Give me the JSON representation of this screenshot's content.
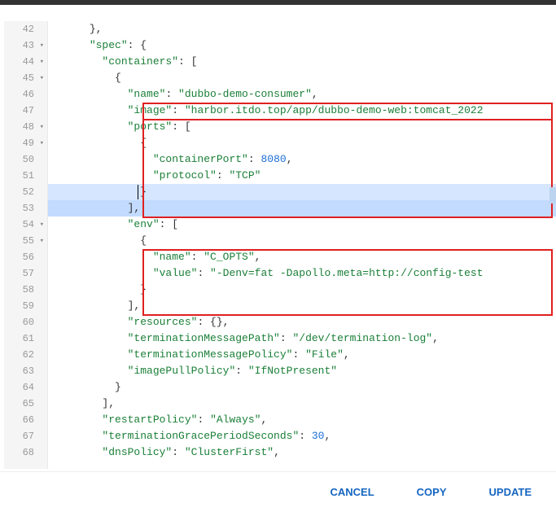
{
  "lines": [
    {
      "num": 42,
      "fold": "",
      "indent": 3,
      "html": "<span class='p'>},</span>"
    },
    {
      "num": 43,
      "fold": "▾",
      "indent": 3,
      "html": "<span class='k'>\"spec\"</span><span class='p'>: {</span>"
    },
    {
      "num": 44,
      "fold": "▾",
      "indent": 4,
      "html": "<span class='k'>\"containers\"</span><span class='p'>: [</span>"
    },
    {
      "num": 45,
      "fold": "▾",
      "indent": 5,
      "html": "<span class='p'>{</span>"
    },
    {
      "num": 46,
      "fold": "",
      "indent": 6,
      "html": "<span class='k'>\"name\"</span><span class='p'>: </span><span class='s'>\"dubbo-demo-consumer\"</span><span class='p'>,</span>"
    },
    {
      "num": 47,
      "fold": "",
      "indent": 6,
      "html": "<span class='k'>\"image\"</span><span class='p'>: </span><span class='s'>\"harbor.itdo.top/app/dubbo-demo-web:tomcat_2022</span>"
    },
    {
      "num": 48,
      "fold": "▾",
      "indent": 6,
      "html": "<span class='k'>\"ports\"</span><span class='p'>: [</span>"
    },
    {
      "num": 49,
      "fold": "▾",
      "indent": 7,
      "html": "<span class='p'>{</span>"
    },
    {
      "num": 50,
      "fold": "",
      "indent": 8,
      "html": "<span class='k'>\"containerPort\"</span><span class='p'>: </span><span class='n'>8080</span><span class='p'>,</span>"
    },
    {
      "num": 51,
      "fold": "",
      "indent": 8,
      "html": "<span class='k'>\"protocol\"</span><span class='p'>: </span><span class='s'>\"TCP\"</span>"
    },
    {
      "num": 52,
      "fold": "",
      "indent": 7,
      "html": "<span class='p'>}</span>",
      "highlight": "line",
      "cursor": true
    },
    {
      "num": 53,
      "fold": "",
      "indent": 6,
      "html": "<span class='p'>],</span>",
      "highlight": "sel"
    },
    {
      "num": 54,
      "fold": "▾",
      "indent": 6,
      "html": "<span class='k'>\"env\"</span><span class='p'>: [</span>"
    },
    {
      "num": 55,
      "fold": "▾",
      "indent": 7,
      "html": "<span class='p'>{</span>"
    },
    {
      "num": 56,
      "fold": "",
      "indent": 8,
      "html": "<span class='k'>\"name\"</span><span class='p'>: </span><span class='s'>\"C_OPTS\"</span><span class='p'>,</span>"
    },
    {
      "num": 57,
      "fold": "",
      "indent": 8,
      "html": "<span class='k'>\"value\"</span><span class='p'>: </span><span class='s'>\"-Denv=fat -Dapollo.meta=http://config-test</span>"
    },
    {
      "num": 58,
      "fold": "",
      "indent": 7,
      "html": "<span class='p'>}</span>"
    },
    {
      "num": 59,
      "fold": "",
      "indent": 6,
      "html": "<span class='p'>],</span>"
    },
    {
      "num": 60,
      "fold": "",
      "indent": 6,
      "html": "<span class='k'>\"resources\"</span><span class='p'>: {},</span>"
    },
    {
      "num": 61,
      "fold": "",
      "indent": 6,
      "html": "<span class='k'>\"terminationMessagePath\"</span><span class='p'>: </span><span class='s'>\"/dev/termination-log\"</span><span class='p'>,</span>"
    },
    {
      "num": 62,
      "fold": "",
      "indent": 6,
      "html": "<span class='k'>\"terminationMessagePolicy\"</span><span class='p'>: </span><span class='s'>\"File\"</span><span class='p'>,</span>"
    },
    {
      "num": 63,
      "fold": "",
      "indent": 6,
      "html": "<span class='k'>\"imagePullPolicy\"</span><span class='p'>: </span><span class='s'>\"IfNotPresent\"</span>"
    },
    {
      "num": 64,
      "fold": "",
      "indent": 5,
      "html": "<span class='p'>}</span>"
    },
    {
      "num": 65,
      "fold": "",
      "indent": 4,
      "html": "<span class='p'>],</span>"
    },
    {
      "num": 66,
      "fold": "",
      "indent": 4,
      "html": "<span class='k'>\"restartPolicy\"</span><span class='p'>: </span><span class='s'>\"Always\"</span><span class='p'>,</span>"
    },
    {
      "num": 67,
      "fold": "",
      "indent": 4,
      "html": "<span class='k'>\"terminationGracePeriodSeconds\"</span><span class='p'>: </span><span class='n'>30</span><span class='p'>,</span>"
    },
    {
      "num": 68,
      "fold": "",
      "indent": 4,
      "html": "<span class='k'>\"dnsPolicy\"</span><span class='p'>: </span><span class='s'>\"ClusterFirst\"</span><span class='p'>,</span>"
    }
  ],
  "indent_unit": "  ",
  "buttons": {
    "cancel": "CANCEL",
    "copy": "COPY",
    "update": "UPDATE"
  }
}
